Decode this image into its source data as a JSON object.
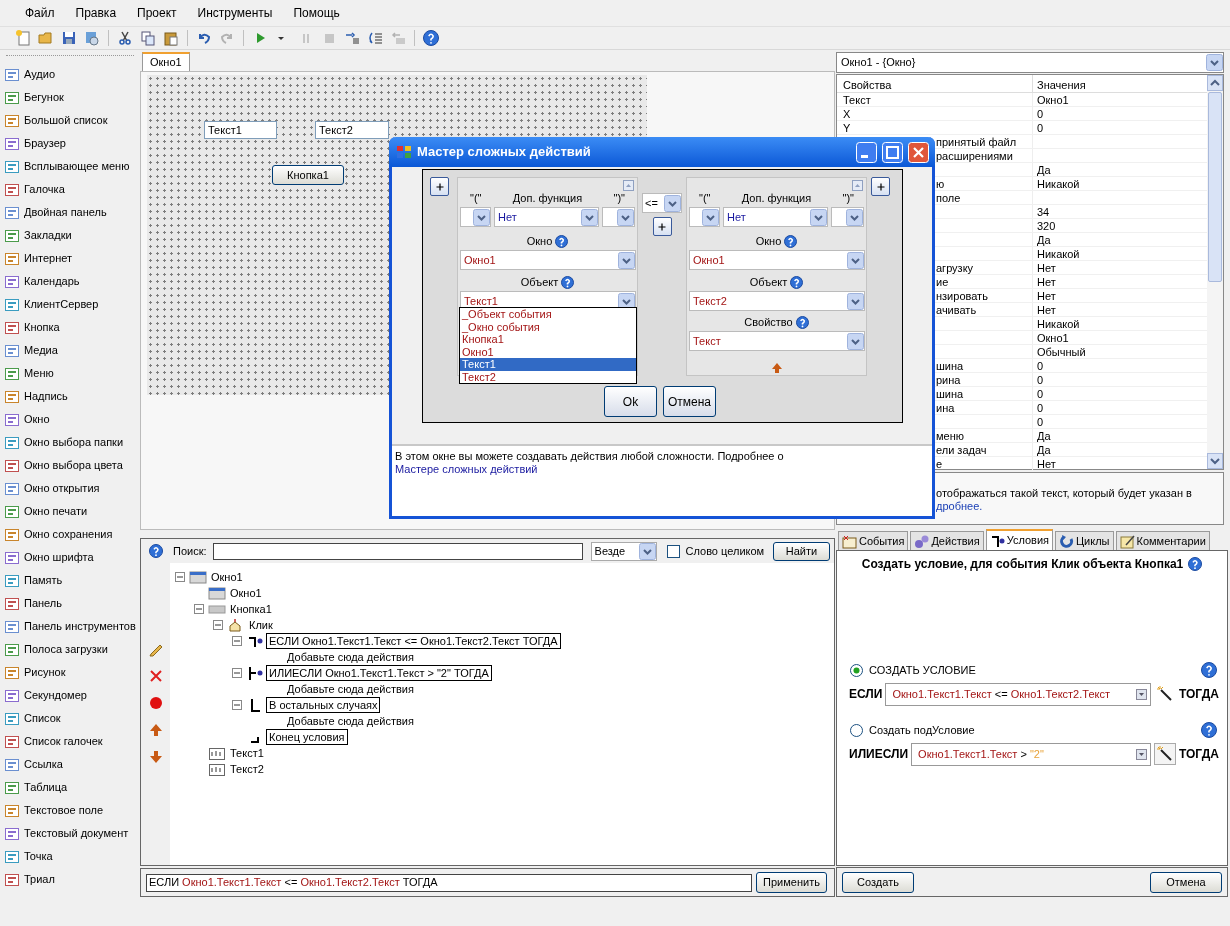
{
  "menu": [
    {
      "label": "Файл"
    },
    {
      "label": "Правка"
    },
    {
      "label": "Проект"
    },
    {
      "label": "Инструменты"
    },
    {
      "label": "Помощь"
    }
  ],
  "toolbar": [
    {
      "kind": "new",
      "disabled": false
    },
    {
      "kind": "open",
      "disabled": false
    },
    {
      "kind": "save",
      "disabled": false
    },
    {
      "kind": "saveall",
      "disabled": false
    },
    {
      "kind": "separator"
    },
    {
      "kind": "cut",
      "disabled": false
    },
    {
      "kind": "copy",
      "disabled": false
    },
    {
      "kind": "paste",
      "disabled": false
    },
    {
      "kind": "separator"
    },
    {
      "kind": "undo",
      "disabled": false
    },
    {
      "kind": "redo",
      "disabled": true
    },
    {
      "kind": "separator"
    },
    {
      "kind": "run",
      "disabled": false
    },
    {
      "kind": "caret",
      "disabled": false
    },
    {
      "kind": "pause",
      "disabled": true
    },
    {
      "kind": "stop",
      "disabled": true
    },
    {
      "kind": "indent",
      "disabled": false
    },
    {
      "kind": "wrap",
      "disabled": false
    },
    {
      "kind": "outdent",
      "disabled": true
    },
    {
      "kind": "separator"
    },
    {
      "kind": "help",
      "disabled": false
    }
  ],
  "toolbox": [
    {
      "label": "Аудио"
    },
    {
      "label": "Бегунок"
    },
    {
      "label": "Большой список"
    },
    {
      "label": "Браузер"
    },
    {
      "label": "Всплывающее меню"
    },
    {
      "label": "Галочка"
    },
    {
      "label": "Двойная панель"
    },
    {
      "label": "Закладки"
    },
    {
      "label": "Интернет"
    },
    {
      "label": "Календарь"
    },
    {
      "label": "КлиентСервер"
    },
    {
      "label": "Кнопка"
    },
    {
      "label": "Медиа"
    },
    {
      "label": "Меню"
    },
    {
      "label": "Надпись"
    },
    {
      "label": "Окно"
    },
    {
      "label": "Окно выбора папки"
    },
    {
      "label": "Окно выбора цвета"
    },
    {
      "label": "Окно открытия"
    },
    {
      "label": "Окно печати"
    },
    {
      "label": "Окно сохранения"
    },
    {
      "label": "Окно шрифта"
    },
    {
      "label": "Память"
    },
    {
      "label": "Панель"
    },
    {
      "label": "Панель инструментов"
    },
    {
      "label": "Полоса загрузки"
    },
    {
      "label": "Рисунок"
    },
    {
      "label": "Секундомер"
    },
    {
      "label": "Список"
    },
    {
      "label": "Список галочек"
    },
    {
      "label": "Ссылка"
    },
    {
      "label": "Таблица"
    },
    {
      "label": "Текстовое поле"
    },
    {
      "label": "Текстовый документ"
    },
    {
      "label": "Точка"
    },
    {
      "label": "Триал"
    }
  ],
  "designer": {
    "tabs": [
      {
        "label": "Окно1",
        "selected": true
      }
    ],
    "controls": [
      {
        "kind": "textbox",
        "value": "Текст1"
      },
      {
        "kind": "textbox",
        "value": "Текст2"
      },
      {
        "kind": "button",
        "label": "Кнопка1"
      }
    ]
  },
  "dialog": {
    "title": "Мастер сложных действий",
    "left": {
      "open_label": "\"(\"",
      "func_label": "Доп. функция",
      "close_label": "\")\"",
      "func": "Нет",
      "window_label": "Окно",
      "window": "Окно1",
      "object_label": "Объект",
      "object": "Текст1",
      "object_options": [
        {
          "label": "_Объект события",
          "selected": false
        },
        {
          "label": "_Окно события",
          "selected": false
        },
        {
          "label": "Кнопка1",
          "selected": false
        },
        {
          "label": "Окно1",
          "selected": false
        },
        {
          "label": "Текст1",
          "selected": true
        },
        {
          "label": "Текст2",
          "selected": false
        }
      ]
    },
    "operator": "<=",
    "right": {
      "open_label": "\"(\"",
      "func_label": "Доп. функция",
      "close_label": "\")\"",
      "func": "Нет",
      "window_label": "Окно",
      "window": "Окно1",
      "object_label": "Объект",
      "object": "Текст2",
      "property_label": "Свойство",
      "property": "Текст"
    },
    "buttons": [
      "Ok",
      "Отмена"
    ],
    "description": "В этом окне вы можете создавать действия любой сложности. Подробнее о ",
    "description_link": "Мастере сложных действий"
  },
  "tree_panel": {
    "search_label": "Поиск:",
    "scope": "Везде",
    "whole_word": {
      "label": "Слово целиком",
      "checked": false
    },
    "find_button": "Найти",
    "tree": [
      {
        "kind": "window",
        "label": "Окно1",
        "expanded": true,
        "children": [
          {
            "kind": "window",
            "label": "Окно1"
          },
          {
            "kind": "button",
            "label": "Кнопка1",
            "expanded": true,
            "children": [
              {
                "kind": "event",
                "label": "Клик",
                "expanded": true,
                "children": [
                  {
                    "kind": "if",
                    "label": "ЕСЛИ Окно1.Текст1.Текст <= Окно1.Текст2.Текст ТОГДА",
                    "expanded": true,
                    "children": [
                      {
                        "kind": "action",
                        "label": "Добавьте сюда действия"
                      }
                    ]
                  },
                  {
                    "kind": "elseif",
                    "label": "ИЛИЕСЛИ Окно1.Текст1.Текст > \"2\" ТОГДА",
                    "expanded": true,
                    "children": [
                      {
                        "kind": "action",
                        "label": "Добавьте сюда действия"
                      }
                    ]
                  },
                  {
                    "kind": "else",
                    "label": "В остальных случаях",
                    "expanded": true,
                    "children": [
                      {
                        "kind": "action",
                        "label": "Добавьте сюда действия"
                      }
                    ]
                  },
                  {
                    "kind": "end",
                    "label": "Конец условия"
                  }
                ]
              }
            ]
          },
          {
            "kind": "text",
            "label": "Текст1"
          },
          {
            "kind": "text",
            "label": "Текст2"
          }
        ]
      }
    ],
    "expression": [
      {
        "kind": "keyword",
        "text": "ЕСЛИ "
      },
      {
        "kind": "ref",
        "text": "Окно1.Текст1.Текст"
      },
      {
        "kind": "op",
        "text": " <= "
      },
      {
        "kind": "ref",
        "text": "Окно1.Текст2.Текст"
      },
      {
        "kind": "keyword",
        "text": " ТОГДА"
      }
    ],
    "apply_button": "Применить"
  },
  "properties": {
    "object": "Окно1 - {Окно}",
    "header": [
      "Свойства",
      "Значения"
    ],
    "rows": [
      {
        "name": "Текст",
        "value": "Окно1",
        "clipped": false
      },
      {
        "name": "X",
        "value": "0",
        "clipped": false
      },
      {
        "name": "Y",
        "value": "0",
        "clipped": false
      },
      {
        "name": "принятый файл",
        "clipped": true
      },
      {
        "name": "расширениями",
        "clipped": true
      },
      {
        "value": "Да"
      },
      {
        "name": "ю",
        "value": "Никакой",
        "clipped": true
      },
      {
        "name": "поле",
        "clipped": true
      },
      {
        "value": "34"
      },
      {
        "value": "320"
      },
      {
        "value": "Да"
      },
      {
        "value": "Никакой"
      },
      {
        "name": "агрузку",
        "value": "Нет",
        "clipped": true
      },
      {
        "name": "ие",
        "value": "Нет",
        "clipped": true
      },
      {
        "name": "нзировать",
        "value": "Нет",
        "clipped": true
      },
      {
        "name": "ачивать",
        "value": "Нет",
        "clipped": true
      },
      {
        "value": "Никакой"
      },
      {
        "value": "Окно1"
      },
      {
        "value": "Обычный"
      },
      {
        "name": "шина",
        "value": "0",
        "clipped": true
      },
      {
        "name": "рина",
        "value": "0",
        "clipped": true
      },
      {
        "name": "шина",
        "value": "0",
        "clipped": true
      },
      {
        "name": "ина",
        "value": "0",
        "clipped": true
      },
      {
        "value": "0"
      },
      {
        "name": "меню",
        "value": "Да",
        "clipped": true
      },
      {
        "name": "ели задач",
        "value": "Да",
        "clipped": true
      },
      {
        "name": "е",
        "value": "Нет",
        "clipped": true
      }
    ],
    "description": "отображаться такой текст, который будет указан в",
    "description_link": "дробнее."
  },
  "condition_panel": {
    "tabs": [
      {
        "kind": "events",
        "label": "События",
        "selected": false
      },
      {
        "kind": "actions",
        "label": "Действия",
        "selected": false
      },
      {
        "kind": "conditions",
        "label": "Условия",
        "selected": true
      },
      {
        "kind": "loops",
        "label": "Циклы",
        "selected": false
      },
      {
        "kind": "comments",
        "label": "Комментарии",
        "selected": false
      }
    ],
    "heading": "Создать условие, для события Клик объекта Кнопка1",
    "options": [
      {
        "label": "СОЗДАТЬ УСЛОВИЕ",
        "selected": true,
        "keyword": "ЕСЛИ",
        "then": "ТОГДА",
        "expression": [
          {
            "kind": "ref",
            "text": "Окно1.Текст1.Текст"
          },
          {
            "kind": "op",
            "text": " <= "
          },
          {
            "kind": "ref",
            "text": "Окно1.Текст2.Текст"
          }
        ]
      },
      {
        "label": "Создать подУсловие",
        "selected": false,
        "keyword": "ИЛИЕСЛИ",
        "then": "ТОГДА",
        "expression": [
          {
            "kind": "ref",
            "text": "Окно1.Текст1.Текст"
          },
          {
            "kind": "op",
            "text": " > "
          },
          {
            "kind": "literal",
            "text": "\"2\""
          }
        ]
      }
    ],
    "buttons": [
      "Создать",
      "Отмена"
    ]
  }
}
